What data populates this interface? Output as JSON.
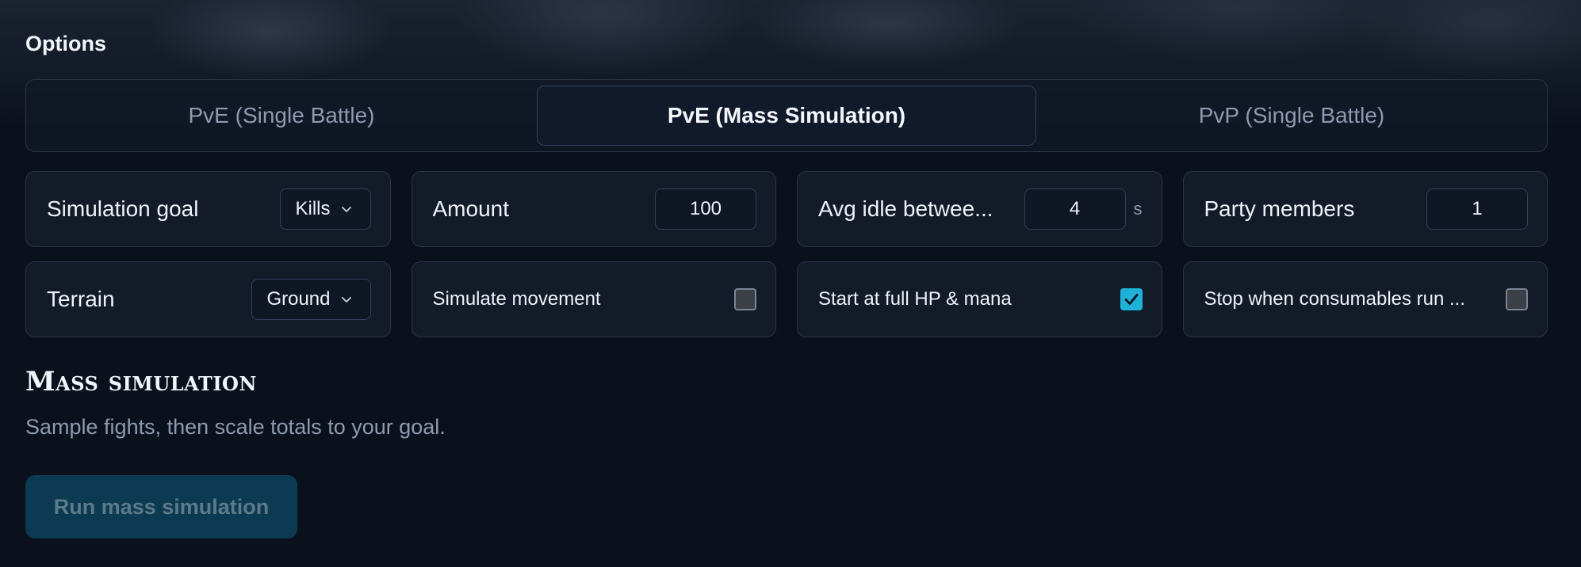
{
  "options": {
    "title": "Options",
    "tabs": [
      {
        "label": "PvE (Single Battle)",
        "active": false
      },
      {
        "label": "PvE (Mass Simulation)",
        "active": true
      },
      {
        "label": "PvP (Single Battle)",
        "active": false
      }
    ]
  },
  "settings": {
    "simulation_goal": {
      "label": "Simulation goal",
      "value": "Kills"
    },
    "amount": {
      "label": "Amount",
      "value": "100"
    },
    "avg_idle": {
      "label": "Avg idle betwee...",
      "value": "4",
      "unit": "s"
    },
    "party_members": {
      "label": "Party members",
      "value": "1"
    },
    "terrain": {
      "label": "Terrain",
      "value": "Ground"
    },
    "simulate_movement": {
      "label": "Simulate movement",
      "checked": false
    },
    "start_full": {
      "label": "Start at full HP & mana",
      "checked": true
    },
    "stop_consumables": {
      "label": "Stop when consumables run ...",
      "checked": false
    }
  },
  "mass_simulation": {
    "title": "Mass simulation",
    "description": "Sample fights, then scale totals to your goal.",
    "run_label": "Run mass simulation"
  },
  "colors": {
    "accent": "#1eb2d8",
    "background": "#0b111c",
    "card": "#131b29",
    "border": "#2a3446",
    "muted_text": "#8e9ab0",
    "run_button_bg": "#0c3a52"
  },
  "icons": {
    "dropdown": "chevron-down-icon",
    "check": "check-icon"
  }
}
